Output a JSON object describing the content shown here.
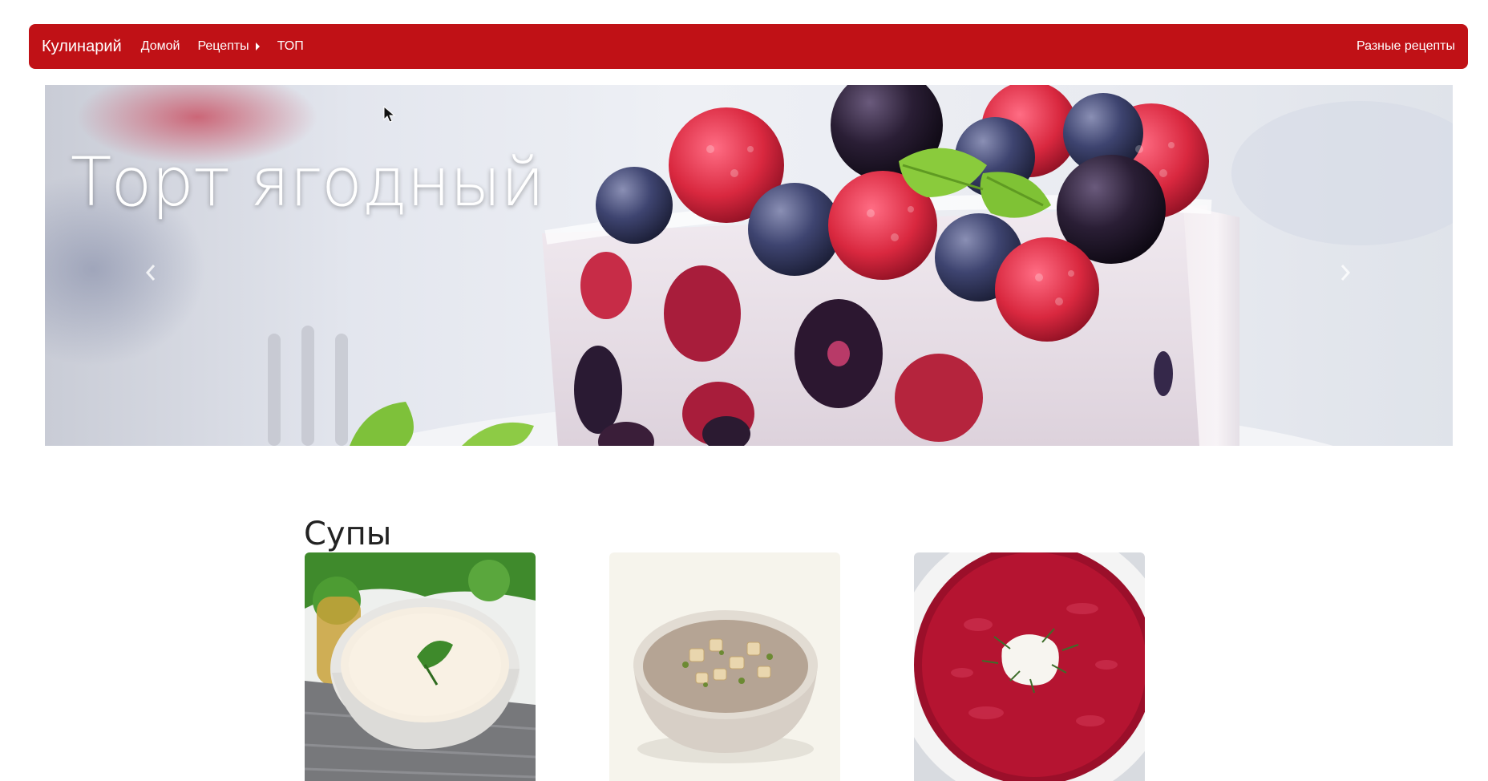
{
  "navbar": {
    "brand": "Кулинарий",
    "links": [
      {
        "label": "Домой",
        "icon": null
      },
      {
        "label": "Рецепты",
        "icon": "caret-right-icon"
      },
      {
        "label": "ТОП",
        "icon": null
      }
    ],
    "right_link": "Разные рецепты",
    "background_color": "#c01116"
  },
  "carousel": {
    "caption": "Торт ягодный",
    "prev_icon": "chevron-left-icon",
    "next_icon": "chevron-right-icon"
  },
  "section": {
    "title": "Супы",
    "cards": [
      {
        "image": "cream-soup-image"
      },
      {
        "image": "mushroom-soup-image"
      },
      {
        "image": "borscht-image"
      }
    ]
  }
}
